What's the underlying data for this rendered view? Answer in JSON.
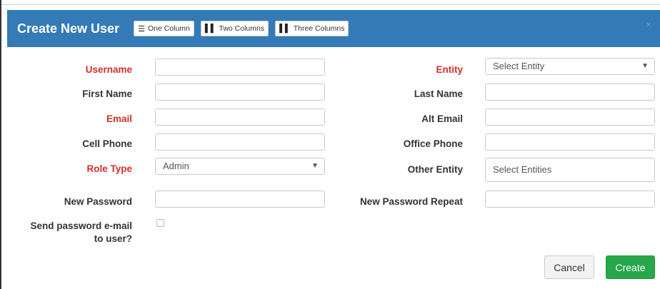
{
  "modal": {
    "title": "Create New User",
    "layout_buttons": [
      {
        "label": "One Column",
        "icon": "list-icon"
      },
      {
        "label": "Two Columns",
        "icon": "two-columns-icon"
      },
      {
        "label": "Three Columns",
        "icon": "three-columns-icon"
      }
    ],
    "close_symbol": "×"
  },
  "form": {
    "username": {
      "label": "Username",
      "value": "",
      "required": true
    },
    "first_name": {
      "label": "First Name",
      "value": ""
    },
    "email": {
      "label": "Email",
      "value": "",
      "required": true
    },
    "cell_phone": {
      "label": "Cell Phone",
      "value": ""
    },
    "role_type": {
      "label": "Role Type",
      "value": "Admin",
      "required": true
    },
    "new_password": {
      "label": "New Password",
      "value": ""
    },
    "send_email": {
      "label_line1": "Send password e-mail",
      "label_line2": "to user?",
      "checked": false
    },
    "entity": {
      "label": "Entity",
      "value": "Select Entity",
      "required": true
    },
    "last_name": {
      "label": "Last Name",
      "value": ""
    },
    "alt_email": {
      "label": "Alt Email",
      "value": ""
    },
    "office_phone": {
      "label": "Office Phone",
      "value": ""
    },
    "other_entity": {
      "label": "Other Entity",
      "placeholder": "Select Entities"
    },
    "new_password_repeat": {
      "label": "New Password Repeat",
      "value": ""
    }
  },
  "footer": {
    "cancel_label": "Cancel",
    "create_label": "Create"
  },
  "colors": {
    "header_bg": "#337ab7",
    "required_label": "#d0302b",
    "create_button": "#27a74a"
  }
}
